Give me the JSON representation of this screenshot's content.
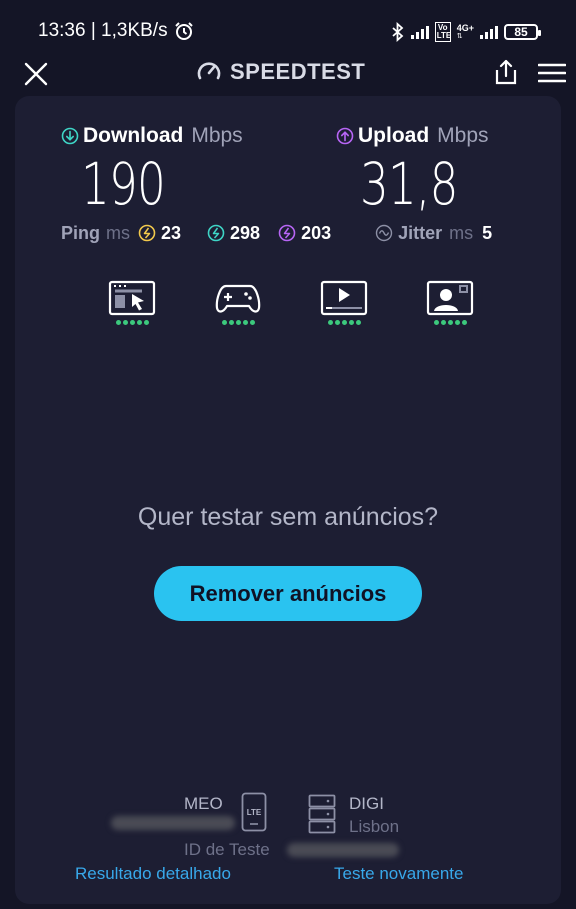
{
  "status_bar": {
    "time": "13:36 | 1,3KB/s",
    "volte": "Vo LTE",
    "network": "4G+",
    "battery": "85"
  },
  "header": {
    "title": "SPEEDTEST"
  },
  "download": {
    "label": "Download",
    "unit": "Mbps",
    "value": "190"
  },
  "upload": {
    "label": "Upload",
    "unit": "Mbps",
    "value": "31,8"
  },
  "ping": {
    "label": "Ping",
    "unit": "ms",
    "idle": "23",
    "download": "298",
    "upload": "203"
  },
  "jitter": {
    "label": "Jitter",
    "unit": "ms",
    "value": "5"
  },
  "activities": [
    {
      "name": "browsing",
      "rating": 5
    },
    {
      "name": "gaming",
      "rating": 5
    },
    {
      "name": "streaming",
      "rating": 5
    },
    {
      "name": "video-calls",
      "rating": 5
    }
  ],
  "promo": {
    "text": "Quer testar sem anúncios?",
    "button": "Remover anúncios"
  },
  "footer": {
    "isp": "MEO",
    "connection": "LTE",
    "server": "DIGI",
    "server_location": "Lisbon",
    "test_id_label": "ID de Teste",
    "detailed_result": "Resultado detalhado",
    "test_again": "Teste novamente"
  },
  "colors": {
    "download": "#3ed5c6",
    "upload": "#b765f5",
    "idle_ping": "#f2c94c",
    "accent": "#2ac3f0",
    "good": "#3cc97d"
  }
}
